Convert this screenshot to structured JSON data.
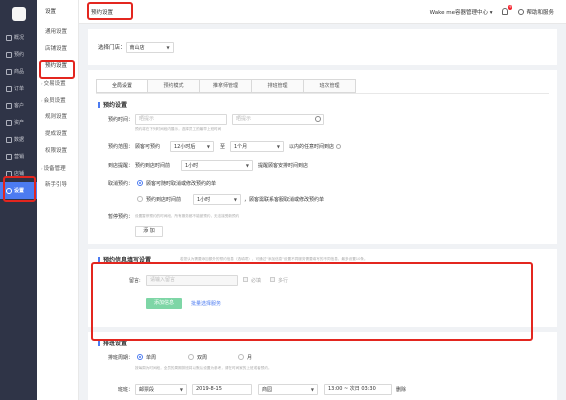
{
  "rail": {
    "items": [
      {
        "label": "概况",
        "icon": "dashboard-icon"
      },
      {
        "label": "预约",
        "icon": "calendar-icon"
      },
      {
        "label": "商品",
        "icon": "goods-icon"
      },
      {
        "label": "订单",
        "icon": "order-icon"
      },
      {
        "label": "客户",
        "icon": "customer-icon"
      },
      {
        "label": "资产",
        "icon": "asset-icon"
      },
      {
        "label": "数据",
        "icon": "data-icon"
      },
      {
        "label": "营销",
        "icon": "marketing-icon"
      },
      {
        "label": "店铺",
        "icon": "store-icon"
      },
      {
        "label": "设置",
        "icon": "gear-icon"
      }
    ]
  },
  "submenu": {
    "title": "设置",
    "items": [
      "通用设置",
      "店铺设置",
      "预约设置",
      "交易设置",
      "会员设置",
      "规则设置",
      "提成设置",
      "权限设置",
      "设备管理",
      "新手引导"
    ]
  },
  "header": {
    "page_title": "预约设置",
    "org": "Wake me容器管理中心 ▾",
    "notif_count": "9",
    "help": "帮助和服务"
  },
  "store": {
    "label": "选择门店：",
    "value": "南山店"
  },
  "tabs": [
    "全局设置",
    "预约模式",
    "推拿师管理",
    "排班管理",
    "班次管理"
  ],
  "booking": {
    "title": "预约设置",
    "time_label": "预约时间：",
    "time_start_ph": "晒提示",
    "time_end_ph": "晒提示",
    "time_hint": "预约将在下列时间段内展示，选择员工的最早上班时间",
    "range_label": "预约范围：",
    "range_prefix": "顾客可预约",
    "range_from": "12小时后",
    "range_to_word": "至",
    "range_to": "1个月",
    "range_suffix": "以内的任意时间到店",
    "remind_label": "到店提醒：",
    "remind_prefix": "预约到店时间前",
    "remind_value": "1小时",
    "remind_suffix": "提醒顾客安排时间到店",
    "cancel_label": "取消预约：",
    "cancel_opt1": "顾客可随时取消或修改预约的单",
    "cancel_opt2_prefix": "预约到店时间前",
    "cancel_opt2_value": "1小时",
    "cancel_opt2_suffix": "，顾客需联系客服取消或修改预约单",
    "pause_label": "暂停预约：",
    "pause_hint": "设置暂停预约的时间段，所有服务都不能被预约，无法接受新预约",
    "add_btn": "添 加"
  },
  "info": {
    "title": "预约信息填写设置",
    "hint": "若您认为需要添加额外的预约信息（选填项），可通过\"添加信息\"设置不同服务需要填写的不同信息，最多设置10条。",
    "remark_label": "留言:",
    "remark_ph": "请输入留言",
    "required": "必填",
    "multi": "多行",
    "add_info_btn": "添加信息",
    "batch_link": "批量选择服务"
  },
  "schedule": {
    "title": "排班设置",
    "cycle_label": "排班周期：",
    "cycle_opt1": "单周",
    "cycle_opt2": "双周",
    "cycle_opt3": "月",
    "cycle_hint": "按每周为时间段，全员的周期排班将以默认设置为参考，请在时间家的上班或者预约。",
    "row_label": "班班：",
    "row_sel1": "邮票段",
    "row_date": "2019-8-15",
    "row_sel2": "商园",
    "row_time": "13:00 ~ 次日 03:30",
    "row_delete": "删除"
  }
}
